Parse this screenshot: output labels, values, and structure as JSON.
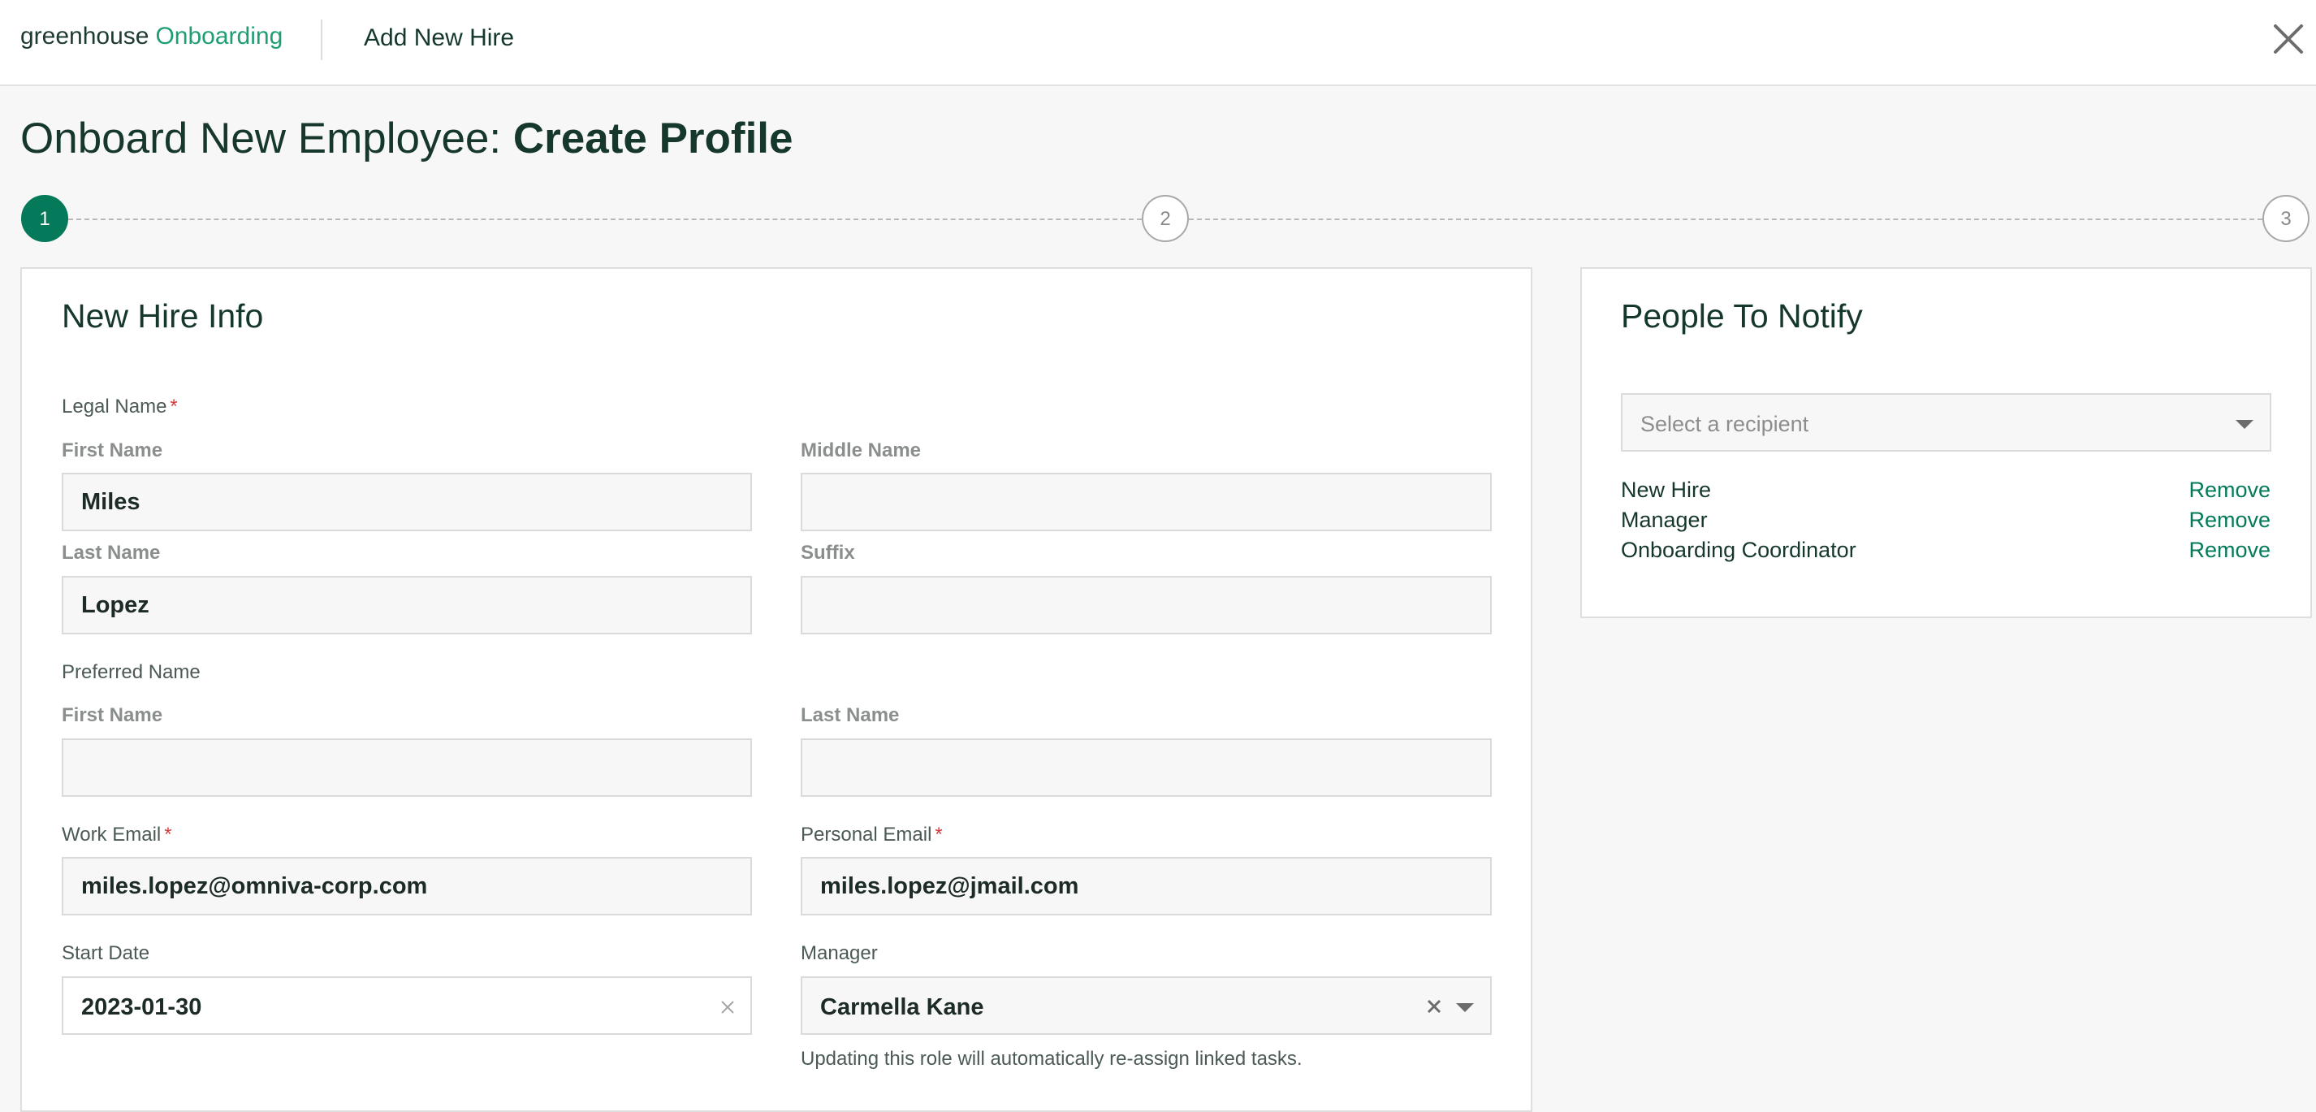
{
  "header": {
    "logo_brand": "greenhouse",
    "logo_product": "Onboarding",
    "title": "Add New Hire",
    "close_icon": "close-icon"
  },
  "page": {
    "heading_prefix": "Onboard New Employee:",
    "heading_step": "Create Profile"
  },
  "stepper": {
    "steps": [
      "1",
      "2",
      "3"
    ],
    "current_step": "1"
  },
  "new_hire_info": {
    "title": "New Hire Info",
    "legal_name": {
      "label": "Legal Name",
      "required_mark": "*",
      "first_name_label": "First Name",
      "first_name_value": "Miles",
      "middle_name_label": "Middle Name",
      "middle_name_value": "",
      "last_name_label": "Last Name",
      "last_name_value": "Lopez",
      "suffix_label": "Suffix",
      "suffix_value": ""
    },
    "preferred_name": {
      "label": "Preferred Name",
      "first_name_label": "First Name",
      "first_name_value": "",
      "last_name_label": "Last Name",
      "last_name_value": ""
    },
    "work_email": {
      "label": "Work Email",
      "required_mark": "*",
      "value": "miles.lopez@omniva-corp.com"
    },
    "personal_email": {
      "label": "Personal Email",
      "required_mark": "*",
      "value": "miles.lopez@jmail.com"
    },
    "start_date": {
      "label": "Start Date",
      "value": "2023-01-30"
    },
    "manager": {
      "label": "Manager",
      "value": "Carmella Kane",
      "help_text": "Updating this role will automatically re-assign linked tasks."
    }
  },
  "people_to_notify": {
    "title": "People To Notify",
    "select_placeholder": "Select a recipient",
    "recipients": [
      {
        "name": "New Hire",
        "action": "Remove"
      },
      {
        "name": "Manager",
        "action": "Remove"
      },
      {
        "name": "Onboarding Coordinator",
        "action": "Remove"
      }
    ]
  },
  "colors": {
    "brand_green": "#047a5a",
    "logo_green": "#1f9e73",
    "text_dark": "#15372c",
    "required_red": "#d23b3b"
  }
}
